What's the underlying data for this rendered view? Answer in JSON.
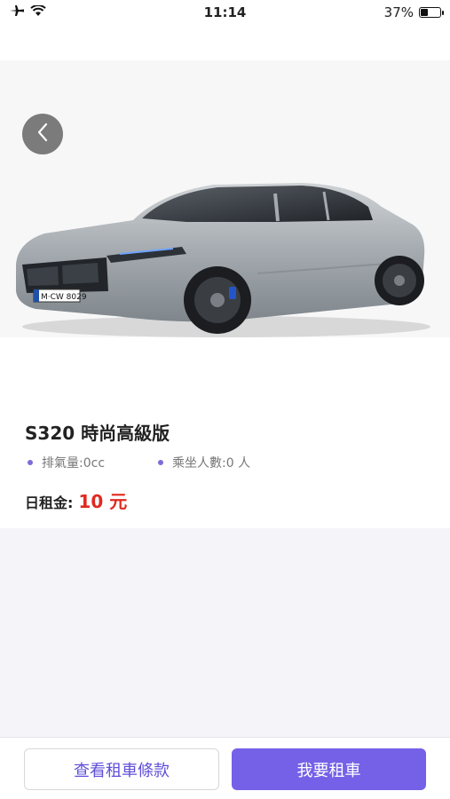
{
  "status_bar": {
    "time": "11:14",
    "battery_percent": "37%",
    "battery_level": 0.37
  },
  "car": {
    "title": "S320 時尚高級版",
    "plate": "M·CW 8029",
    "specs": [
      "排氣量:0cc",
      "乘坐人數:0 人"
    ],
    "price_label": "日租金:",
    "price_value": "10 元"
  },
  "actions": {
    "terms_label": "查看租車條款",
    "rent_label": "我要租車"
  },
  "colors": {
    "accent": "#7560e8",
    "price": "#e0291f",
    "car_body": "#a7adb2"
  }
}
